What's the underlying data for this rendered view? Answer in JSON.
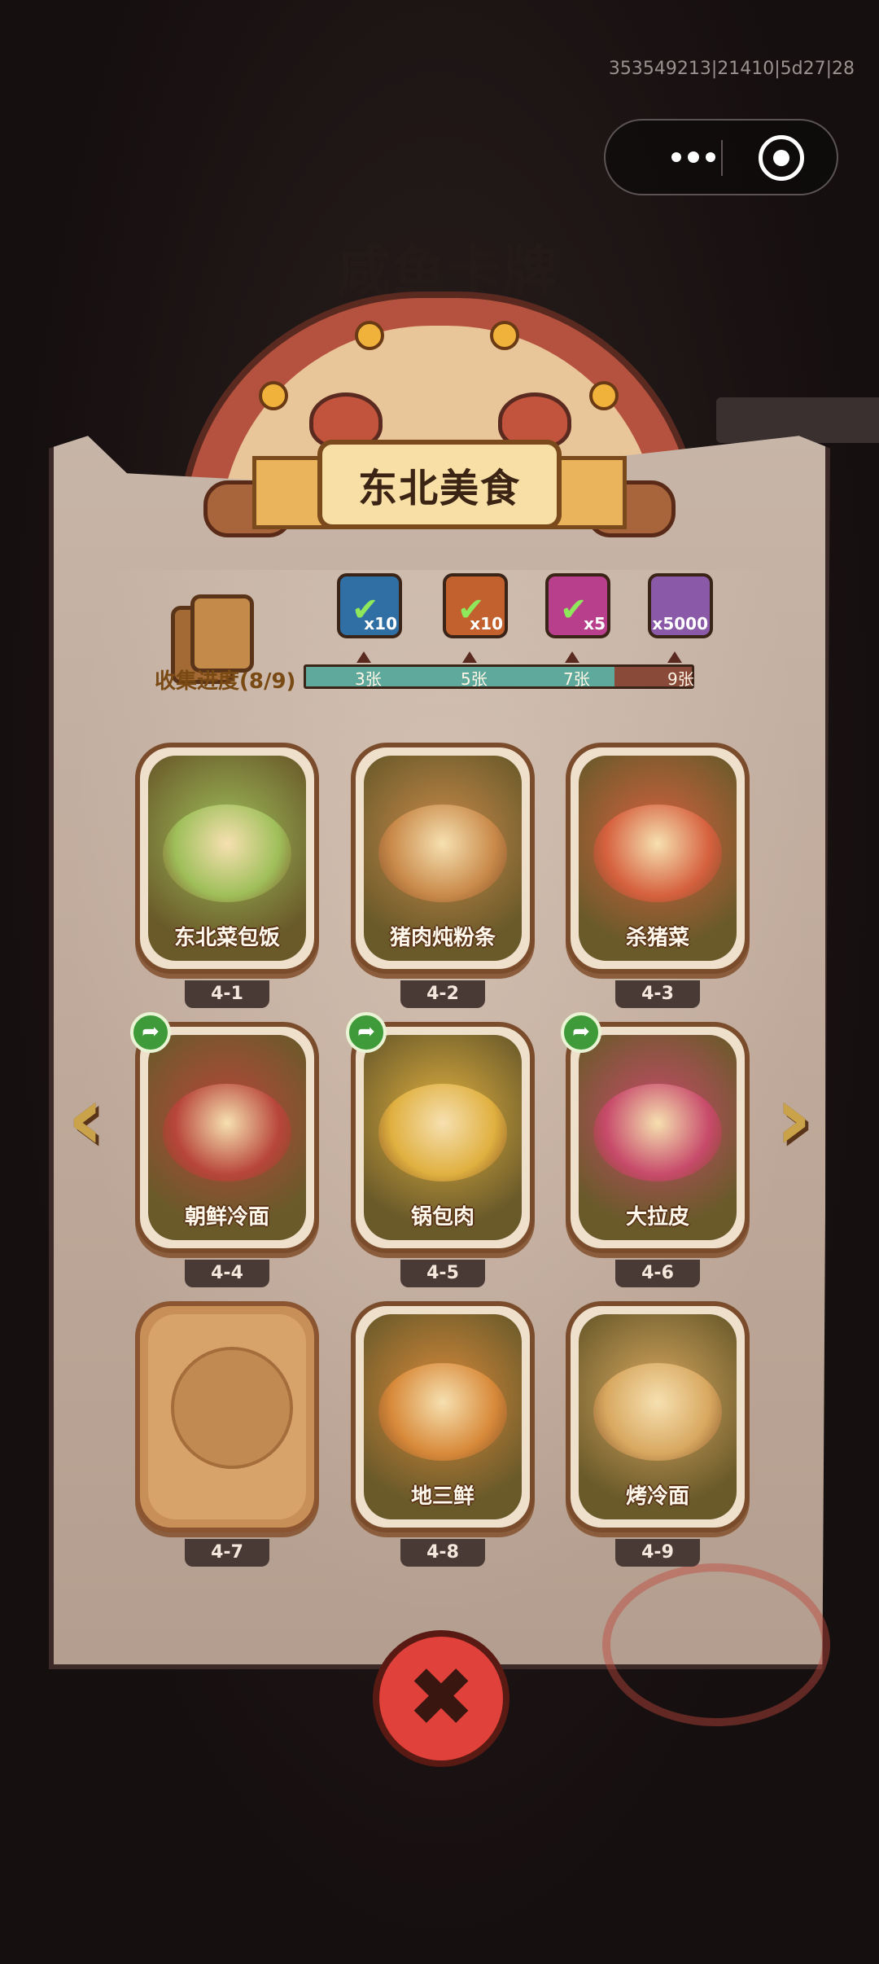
{
  "debug_id": "353549213|21410|5d27|28",
  "background_title": "咸鱼卡牌",
  "capsule": {
    "more_label": "more",
    "close_label": "exit"
  },
  "panel": {
    "title": "东北美食"
  },
  "progress": {
    "label": "收集进度(8/9)",
    "collected": 8,
    "total": 9,
    "fill_fraction": 0.8,
    "milestones": [
      {
        "label": "3张",
        "reward_qty": "x10",
        "claimed": true,
        "reward_icon": "ticket-icon",
        "color": "#2f6fa3"
      },
      {
        "label": "5张",
        "reward_qty": "x10",
        "claimed": true,
        "reward_icon": "card-pack-icon",
        "color": "#c2612e"
      },
      {
        "label": "7张",
        "reward_qty": "x5",
        "claimed": true,
        "reward_icon": "gem-icon",
        "color": "#b83f8c"
      },
      {
        "label": "9张",
        "reward_qty": "x5000",
        "claimed": false,
        "reward_icon": "crystal-icon",
        "color": "#8a5aa8"
      }
    ]
  },
  "cards": [
    {
      "name": "东北菜包饭",
      "level": "4-1",
      "shared": false,
      "locked": false,
      "tint": "#9fbf5a"
    },
    {
      "name": "猪肉炖粉条",
      "level": "4-2",
      "shared": false,
      "locked": false,
      "tint": "#c98a4a"
    },
    {
      "name": "杀猪菜",
      "level": "4-3",
      "shared": false,
      "locked": false,
      "tint": "#d6613f"
    },
    {
      "name": "朝鲜冷面",
      "level": "4-4",
      "shared": true,
      "locked": false,
      "tint": "#b8463a"
    },
    {
      "name": "锅包肉",
      "level": "4-5",
      "shared": true,
      "locked": false,
      "tint": "#e0b040"
    },
    {
      "name": "大拉皮",
      "level": "4-6",
      "shared": true,
      "locked": false,
      "tint": "#c74a6a"
    },
    {
      "name": "",
      "level": "4-7",
      "shared": false,
      "locked": true,
      "tint": "#d8a36a"
    },
    {
      "name": "地三鲜",
      "level": "4-8",
      "shared": false,
      "locked": false,
      "tint": "#d88a3a"
    },
    {
      "name": "烤冷面",
      "level": "4-9",
      "shared": false,
      "locked": false,
      "tint": "#d8a860"
    }
  ],
  "nav": {
    "prev_glyph": "‹",
    "next_glyph": "›"
  },
  "close_glyph": "✖"
}
